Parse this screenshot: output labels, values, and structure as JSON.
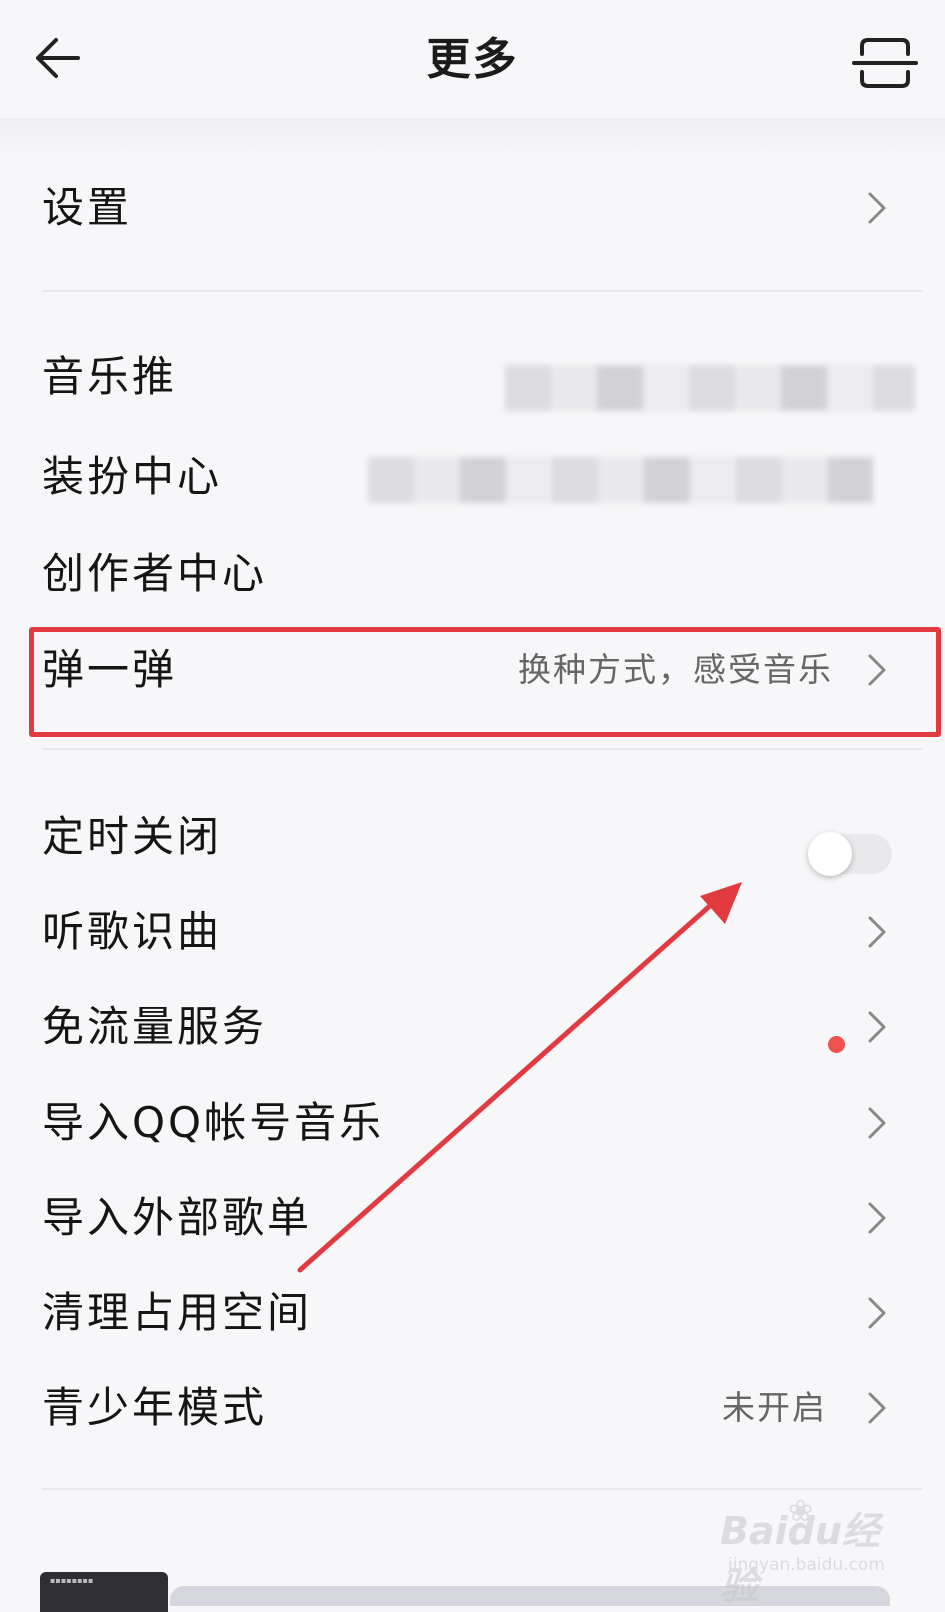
{
  "header": {
    "title": "更多"
  },
  "menu": {
    "settings": "设置",
    "music_push": "音乐推",
    "dress_center": "装扮中心",
    "creator_center": "创作者中心",
    "tanyitan": {
      "label": "弹一弹",
      "sub": "换种方式，感受音乐"
    },
    "timer_off": {
      "label": "定时关闭",
      "toggle_on": false
    },
    "song_recognition": "听歌识曲",
    "free_data": "免流量服务",
    "import_qq": "导入QQ帐号音乐",
    "import_external": "导入外部歌单",
    "clean_space": "清理占用空间",
    "teen_mode": {
      "label": "青少年模式",
      "status": "未开启"
    }
  },
  "watermark": {
    "logo": "Baidu经验",
    "url": "jingyan.baidu.com"
  },
  "colors": {
    "highlight": "#e13a40",
    "dot": "#ef5350",
    "arrow": "#e13a40"
  }
}
